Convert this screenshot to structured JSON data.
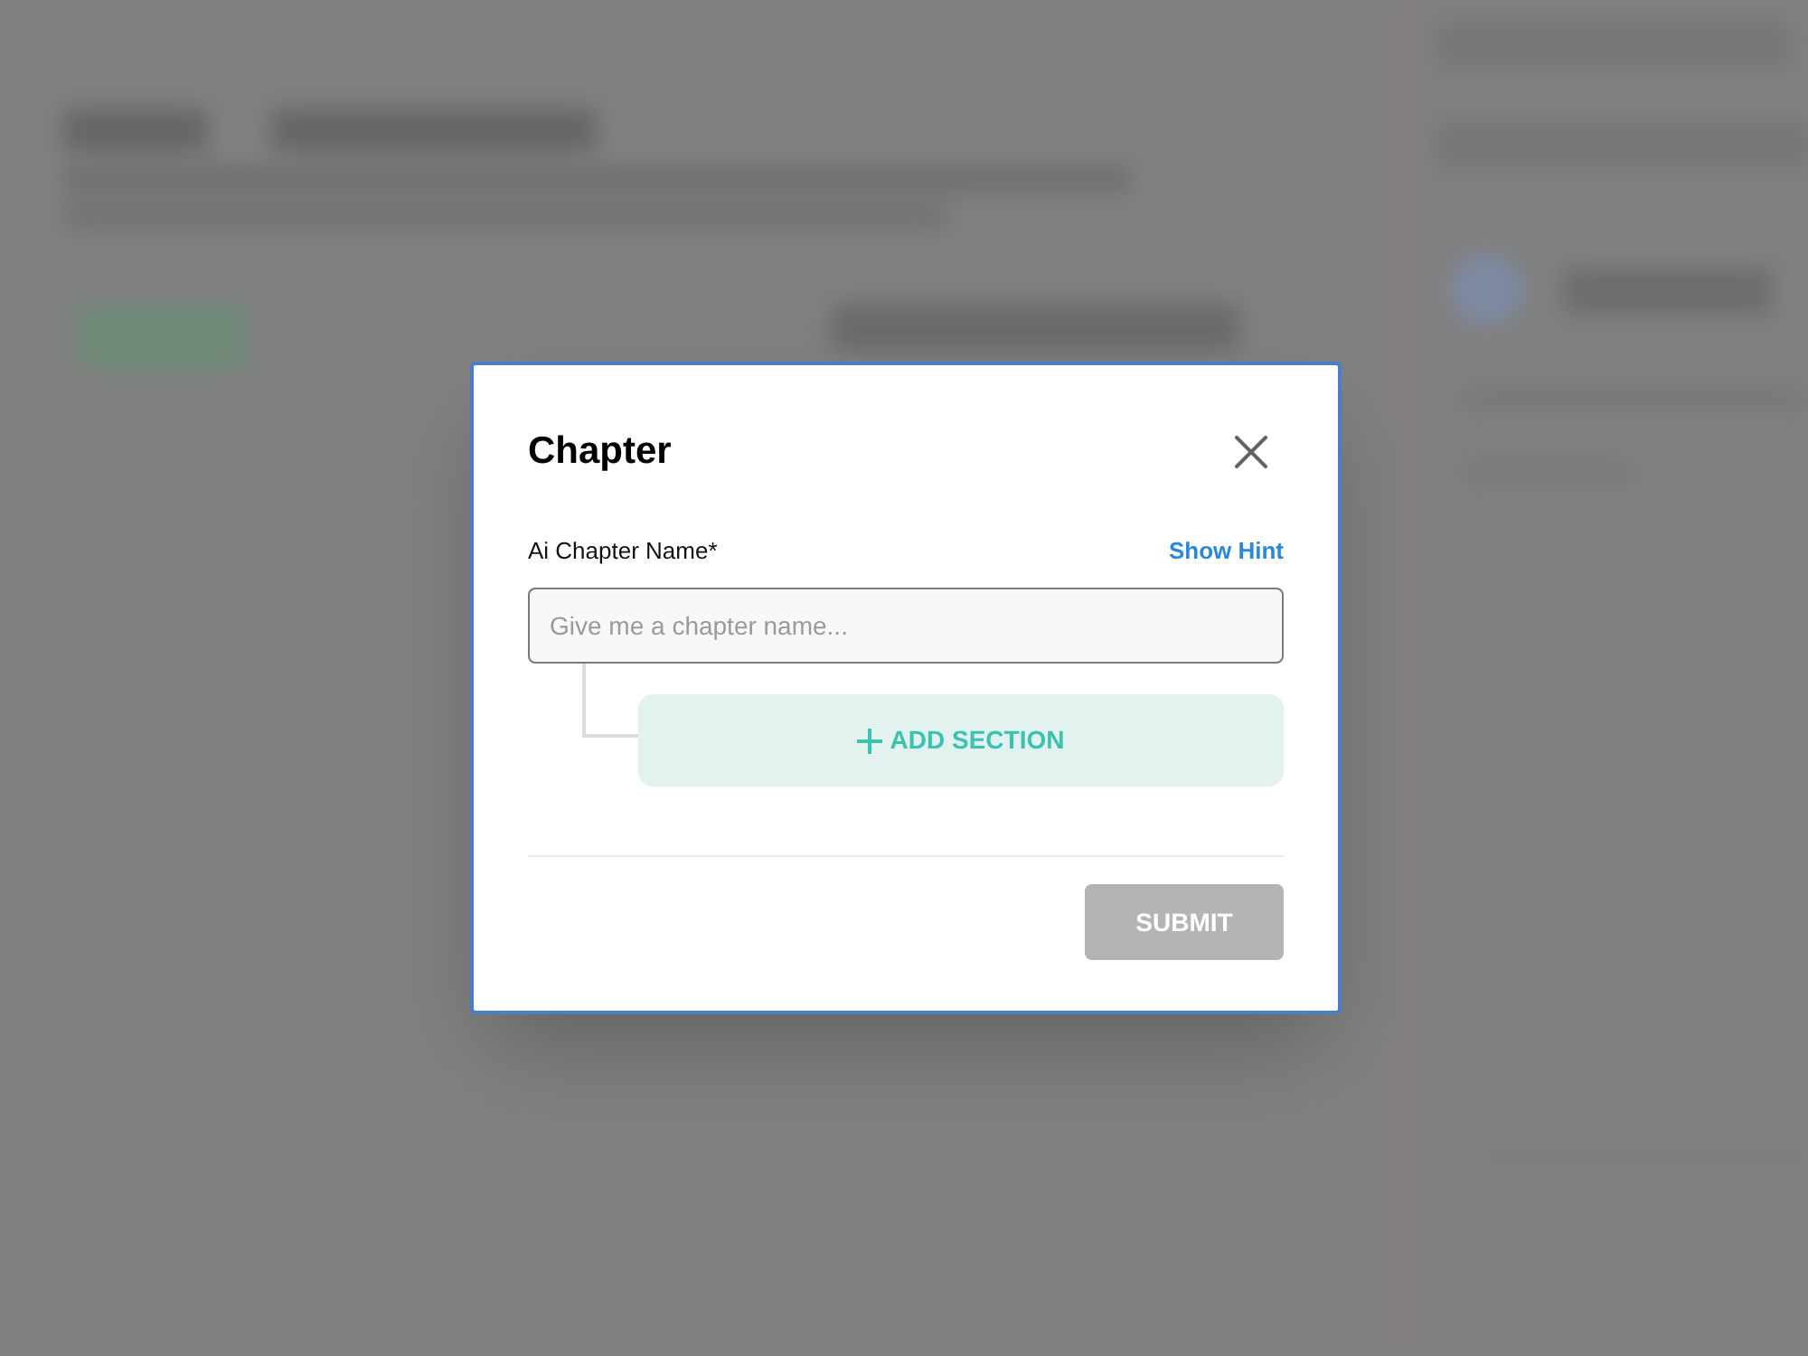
{
  "dialog": {
    "title": "Chapter",
    "field": {
      "label": "Ai Chapter Name*",
      "hint_link": "Show Hint",
      "placeholder": "Give me a chapter name..."
    },
    "add_section": {
      "label": "ADD SECTION"
    },
    "submit": {
      "label": "SUBMIT",
      "disabled": true
    }
  }
}
